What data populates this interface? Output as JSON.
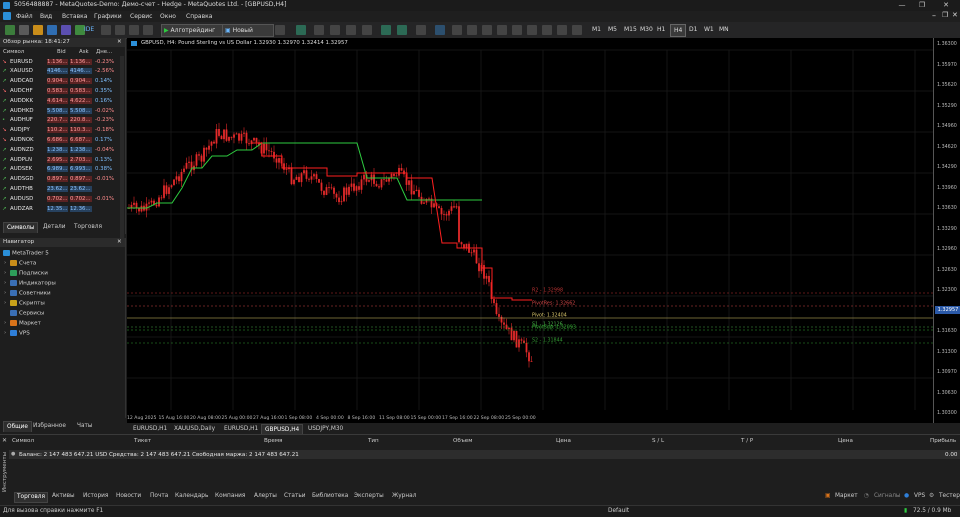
{
  "titlebar": {
    "title": "5056488887 - MetaQuotes-Demo: Демо-счет - Hedge - MetaQuotes Ltd. - [GBPUSD,H4]",
    "minimize": "—",
    "maximize": "❐",
    "close": "✕"
  },
  "menu": [
    "Файл",
    "Вид",
    "Вставка",
    "Графики",
    "Сервис",
    "Окно",
    "Справка"
  ],
  "toolbar": {
    "ide": "IDE",
    "algotrading": "Алготрейдинг",
    "new_order": "Новый ордер",
    "timeframes": [
      "M1",
      "M5",
      "M15",
      "M30",
      "H1",
      "H4",
      "D1",
      "W1",
      "MN"
    ],
    "active_timeframe": "H4"
  },
  "market_watch": {
    "title": "Обзор рынка: 18:41:27",
    "close": "✕",
    "columns": [
      "Символ",
      "Bid",
      "Ask",
      "Дне..."
    ],
    "rows": [
      {
        "symbol": "EURUSD",
        "bid": "1.136...",
        "ask": "1.136...",
        "change": "-0.23%",
        "dir": "down"
      },
      {
        "symbol": "XAUUSD",
        "bid": "4146....",
        "ask": "4146....",
        "change": "-2.56%",
        "dir": "up"
      },
      {
        "symbol": "AUDCAD",
        "bid": "0.904...",
        "ask": "0.904...",
        "change": "0.14%",
        "dir": "up"
      },
      {
        "symbol": "AUDCHF",
        "bid": "0.583...",
        "ask": "0.583...",
        "change": "0.35%",
        "dir": "down"
      },
      {
        "symbol": "AUDDKK",
        "bid": "4.614...",
        "ask": "4.622...",
        "change": "0.16%",
        "dir": "up"
      },
      {
        "symbol": "AUDHKD",
        "bid": "5.508...",
        "ask": "5.508...",
        "change": "-0.02%",
        "dir": "up"
      },
      {
        "symbol": "AUDHUF",
        "bid": "220.7...",
        "ask": "220.8...",
        "change": "-0.23%",
        "dir": "neutral"
      },
      {
        "symbol": "AUDJPY",
        "bid": "110.2...",
        "ask": "110.3...",
        "change": "-0.18%",
        "dir": "down"
      },
      {
        "symbol": "AUDNOK",
        "bid": "6.686...",
        "ask": "6.687...",
        "change": "0.17%",
        "dir": "down"
      },
      {
        "symbol": "AUDNZD",
        "bid": "1.238...",
        "ask": "1.238...",
        "change": "-0.04%",
        "dir": "up"
      },
      {
        "symbol": "AUDPLN",
        "bid": "2.695...",
        "ask": "2.703...",
        "change": "0.13%",
        "dir": "up"
      },
      {
        "symbol": "AUDSEK",
        "bid": "6.989...",
        "ask": "6.993...",
        "change": "0.38%",
        "dir": "up"
      },
      {
        "symbol": "AUDSGD",
        "bid": "0.897...",
        "ask": "0.897...",
        "change": "-0.01%",
        "dir": "up"
      },
      {
        "symbol": "AUDTHB",
        "bid": "23.62...",
        "ask": "23.62...",
        "change": "",
        "dir": "up"
      },
      {
        "symbol": "AUDUSD",
        "bid": "0.702...",
        "ask": "0.702...",
        "change": "-0.01%",
        "dir": "up"
      },
      {
        "symbol": "AUDZAR",
        "bid": "12.35...",
        "ask": "12.36...",
        "change": "",
        "dir": "up"
      }
    ],
    "tabs": [
      "Символы",
      "Детали",
      "Торговля"
    ],
    "active_tab": "Символы"
  },
  "navigator": {
    "title": "Навигатор",
    "close": "✕",
    "root": "MetaTrader 5",
    "items": [
      "Счета",
      "Подписки",
      "Индикаторы",
      "Советники",
      "Скрипты",
      "Сервисы",
      "Маркет",
      "VPS"
    ],
    "tabs": [
      "Общие",
      "Избранное",
      "Чаты"
    ],
    "active_tab": "Общие"
  },
  "chart": {
    "header": "GBPUSD, H4:  Pound Sterling vs US Dollar  1.32930 1.32970 1.32414 1.32957",
    "level_labels": [
      "R2 - 1.32998",
      "PivotRes: 1.32662",
      "Pivot: 1.32404",
      "S1 - 1.32126",
      "PivotSup: 1.32093",
      "S2 - 1.31844"
    ],
    "price_ticks": [
      "1.36300",
      "1.35970",
      "1.35620",
      "1.35290",
      "1.34960",
      "1.34620",
      "1.34290",
      "1.33960",
      "1.33630",
      "1.33290",
      "1.32960",
      "1.32630",
      "1.32300",
      "1.31960",
      "1.31630",
      "1.31300",
      "1.30970",
      "1.30630",
      "1.30300"
    ],
    "current_price": "1.32957",
    "time_ticks": [
      "12 Aug 2025",
      "15 Aug 16:00",
      "20 Aug 08:00",
      "25 Aug 00:00",
      "27 Aug 16:00",
      "1 Sep 08:00",
      "4 Sep 00:00",
      "8 Sep 16:00",
      "11 Sep 08:00",
      "15 Sep 00:00",
      "17 Sep 16:00",
      "22 Sep 08:00",
      "25 Sep 00:00"
    ],
    "colors": {
      "candle": "#e52a2a",
      "support": "#2ecc40",
      "resistance": "#ff2020",
      "grid": "#262626"
    }
  },
  "chart_tabs": [
    "EURUSD,H1",
    "XAUUSD,Daily",
    "EURUSD,H1",
    "GBPUSD,H4",
    "USDJPY,M30"
  ],
  "active_chart_tab": "GBPUSD,H4",
  "terminal": {
    "columns": [
      "Символ",
      "Тикет",
      "Время",
      "Тип",
      "Объем",
      "Цена",
      "S / L",
      "T / P",
      "Цена",
      "Прибыль"
    ],
    "balance_line": "Баланс: 2 147 483 647.21 USD  Средства: 2 147 483 647.21  Свободная маржа: 2 147 483 647.21",
    "profit": "0.00",
    "tabs": [
      "Торговля",
      "Активы",
      "История",
      "Новости",
      "Почта",
      "Календарь",
      "Компания",
      "Алерты",
      "Статьи",
      "Библиотека",
      "Эксперты",
      "Журнал"
    ],
    "active_tab": "Торговля",
    "right_tabs": [
      "Маркет",
      "Сигналы",
      "VPS",
      "Тестер"
    ],
    "side_label": "Инструменты",
    "close": "✕"
  },
  "statusbar": {
    "help": "Для вызова справки нажмите F1",
    "profile": "Default",
    "connection": "72.5 / 0.9 Mb"
  }
}
